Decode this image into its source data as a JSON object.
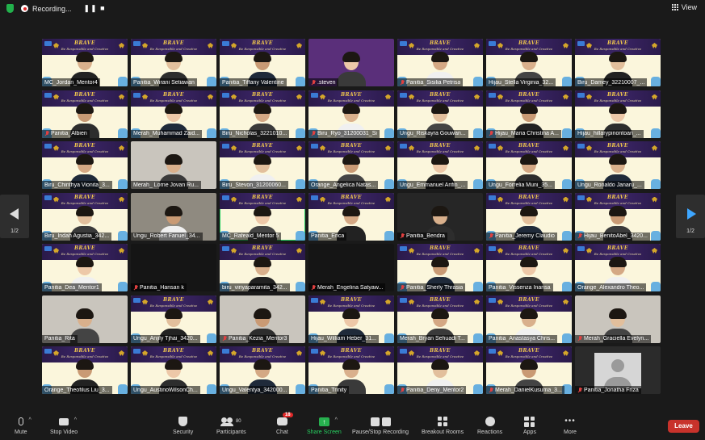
{
  "topbar": {
    "recording_label": "Recording...",
    "recording_controls": "❚❚ ■",
    "view_label": "View"
  },
  "banner": {
    "word": "BRAVE",
    "subtitle": "Be Responsible and Creative"
  },
  "pager": {
    "left_label": "1/2",
    "right_label": "1/2"
  },
  "participants": [
    {
      "name": "MC_Jordan_Mentor4",
      "muted": false,
      "bg": "banner"
    },
    {
      "name": "Panitia_Wirani Setiawan",
      "muted": false,
      "bg": "banner"
    },
    {
      "name": "Panitia_Tiffany Valentine",
      "muted": false,
      "bg": "banner"
    },
    {
      "name": ".steven",
      "muted": true,
      "bg": "purple"
    },
    {
      "name": "Panitia_Sisilia Petrisa",
      "muted": true,
      "bg": "banner"
    },
    {
      "name": "Hijau_Stella Virginia_32...",
      "muted": false,
      "bg": "banner"
    },
    {
      "name": "Biru_Damey_32210007_...",
      "muted": false,
      "bg": "banner"
    },
    {
      "name": "Panitia_Albien",
      "muted": true,
      "bg": "banner"
    },
    {
      "name": "Merah_Muhammad Zaid...",
      "muted": false,
      "bg": "banner"
    },
    {
      "name": "Biru_Nicholas_3221010...",
      "muted": false,
      "bg": "banner"
    },
    {
      "name": "Biru_Ryo_31200031_Si",
      "muted": true,
      "bg": "banner"
    },
    {
      "name": "Ungu_Riskayra Gouwan...",
      "muted": false,
      "bg": "banner"
    },
    {
      "name": "Hijau_Maria Christina A...",
      "muted": true,
      "bg": "banner"
    },
    {
      "name": "Hijau_hillarypinontoan_...",
      "muted": false,
      "bg": "banner"
    },
    {
      "name": "Biru_Chinthya Vionita_3...",
      "muted": false,
      "bg": "banner"
    },
    {
      "name": "Merah_ Lorne Jovan Ru...",
      "muted": false,
      "bg": "room"
    },
    {
      "name": "Biru_Stevon_31200060...",
      "muted": false,
      "bg": "banner"
    },
    {
      "name": "Orange_Angelica Natas...",
      "muted": false,
      "bg": "banner"
    },
    {
      "name": "Ungu_Emmanuel Arifin_...",
      "muted": false,
      "bg": "banner"
    },
    {
      "name": "Ungu_Forrelia Muni_35...",
      "muted": false,
      "bg": "banner"
    },
    {
      "name": "Ungu_Ronaldo Janaru_...",
      "muted": false,
      "bg": "banner"
    },
    {
      "name": "Biru_Indah Agustia_342...",
      "muted": false,
      "bg": "banner"
    },
    {
      "name": "Ungu_Robert Fanuel_34...",
      "muted": false,
      "bg": "room2"
    },
    {
      "name": "MC_Rafeald_Mentor 5",
      "muted": false,
      "bg": "banner",
      "active": true
    },
    {
      "name": "Panitia_Erica",
      "muted": false,
      "bg": "banner"
    },
    {
      "name": "Panitia_Bendra",
      "muted": true,
      "bg": "dark"
    },
    {
      "name": "Panitia_Jeremy Claudio",
      "muted": true,
      "bg": "banner"
    },
    {
      "name": "Hijau_BenitoAbel_3420...",
      "muted": true,
      "bg": "banner"
    },
    {
      "name": "Panitia_Dea_Mentor1",
      "muted": false,
      "bg": "banner"
    },
    {
      "name": "Panitia_Hansan k",
      "muted": true,
      "bg": "black"
    },
    {
      "name": "biru_viriyaparamita_342...",
      "muted": false,
      "bg": "banner"
    },
    {
      "name": "Merah_Engelina Satyaw...",
      "muted": true,
      "bg": "black"
    },
    {
      "name": "Panitia_Sherly Thrasia",
      "muted": true,
      "bg": "banner"
    },
    {
      "name": "Panitia_Vissenza Inansa",
      "muted": false,
      "bg": "banner"
    },
    {
      "name": "Orange_Alexandro Theo...",
      "muted": false,
      "bg": "banner"
    },
    {
      "name": "Panitia_Rita",
      "muted": false,
      "bg": "room"
    },
    {
      "name": "Ungu_Anjily Tjhai_3420...",
      "muted": false,
      "bg": "banner"
    },
    {
      "name": "Panitia_Kezia_Mentor3",
      "muted": true,
      "bg": "room"
    },
    {
      "name": "Hijau_William Heber_31...",
      "muted": false,
      "bg": "banner"
    },
    {
      "name": "Merah_Bryan Sehuadi T...",
      "muted": false,
      "bg": "banner"
    },
    {
      "name": "Panitia_Anastasya Chris...",
      "muted": false,
      "bg": "banner"
    },
    {
      "name": "Merah_Graciella Evelyn...",
      "muted": true,
      "bg": "room"
    },
    {
      "name": "Orange_Theofilus Liu_3...",
      "muted": false,
      "bg": "banner"
    },
    {
      "name": "Ungu_AustinoWilsonCh...",
      "muted": false,
      "bg": "banner"
    },
    {
      "name": "Ungu_Valentya_342000...",
      "muted": false,
      "bg": "banner"
    },
    {
      "name": "Panitia_Trinity",
      "muted": false,
      "bg": "banner"
    },
    {
      "name": "Panitia_Deny_Mentor2",
      "muted": true,
      "bg": "banner"
    },
    {
      "name": "Merah_DanielKusuma_3...",
      "muted": true,
      "bg": "banner"
    },
    {
      "name": "Panitia_Jonatha Friza",
      "muted": true,
      "bg": "avatar"
    }
  ],
  "toolbar": {
    "mute_label": "Mute",
    "video_label": "Stop Video",
    "security_label": "Security",
    "participants_label": "Participants",
    "participants_count": "80",
    "chat_label": "Chat",
    "chat_badge": "18",
    "share_label": "Share Screen",
    "record_label": "Pause/Stop Recording",
    "breakout_label": "Breakout Rooms",
    "reactions_label": "Reactions",
    "apps_label": "Apps",
    "more_label": "More",
    "leave_label": "Leave"
  },
  "colors": {
    "accent_green": "#23d160",
    "leave_red": "#c8322b",
    "banner_purple": "#3b2566"
  }
}
